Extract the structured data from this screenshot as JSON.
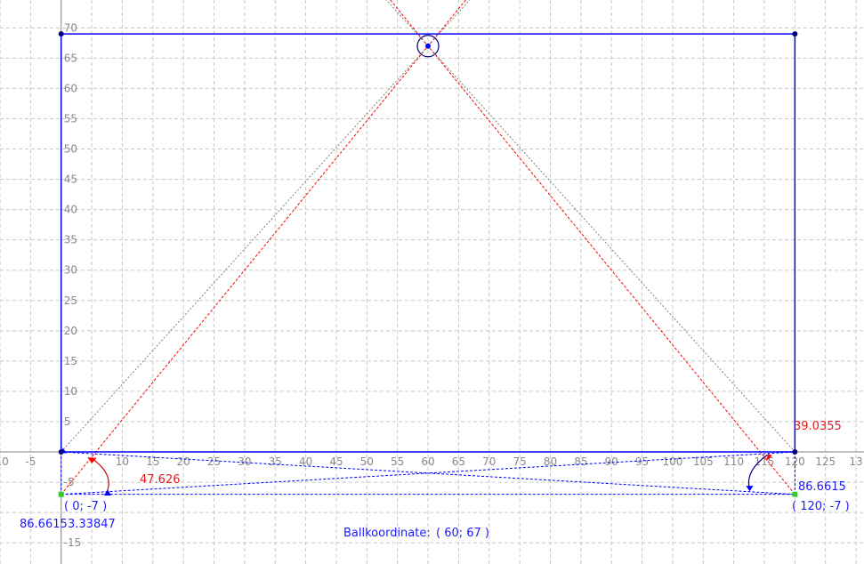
{
  "view": {
    "x_min": -10,
    "x_max": 131.3,
    "y_min": -18.5,
    "y_max": 74.6
  },
  "axes": {
    "x_ticks": [
      -10,
      -5,
      10,
      15,
      20,
      25,
      30,
      35,
      40,
      45,
      50,
      55,
      60,
      65,
      70,
      75,
      80,
      85,
      90,
      95,
      100,
      105,
      110,
      115,
      120,
      125,
      13
    ],
    "y_ticks": [
      70,
      65,
      60,
      55,
      50,
      45,
      40,
      35,
      30,
      25,
      20,
      15,
      10,
      5,
      -5,
      -15
    ],
    "grid_step": 5,
    "grid": true
  },
  "colors": {
    "grid": "#c8c8c8",
    "axis": "#808080",
    "blue": "#0000ff",
    "dark_blue": "#00007f",
    "red": "#ff0000",
    "dark_red": "#cc0000",
    "gray": "#808080",
    "green": "#33cc33",
    "label_blue": "#1a1aff",
    "label_red": "#e41a1c"
  },
  "field": {
    "corners": [
      [
        0,
        0
      ],
      [
        120,
        0
      ],
      [
        120,
        69
      ],
      [
        0,
        69
      ]
    ]
  },
  "ball": {
    "x": 60,
    "y": 67
  },
  "points": [
    {
      "id": "origin",
      "x": 0,
      "y": 0
    },
    {
      "id": "right-base",
      "x": 120,
      "y": 0
    },
    {
      "id": "bottom-left",
      "x": 0,
      "y": -7
    },
    {
      "id": "bottom-right",
      "x": 120,
      "y": -7
    }
  ],
  "labels": {
    "coord_left": "( 0; -7 )",
    "coord_right": "( 120; -7 )",
    "angle_left_red": "47.626",
    "angle_right_red": "39.0355",
    "value_left_blue": "86.6615",
    "value_left_second": "3.33847",
    "value_right_blue": "86.6615",
    "ball_caption": "Ballkoordinate:",
    "ball_coords": "( 60; 67 )"
  }
}
